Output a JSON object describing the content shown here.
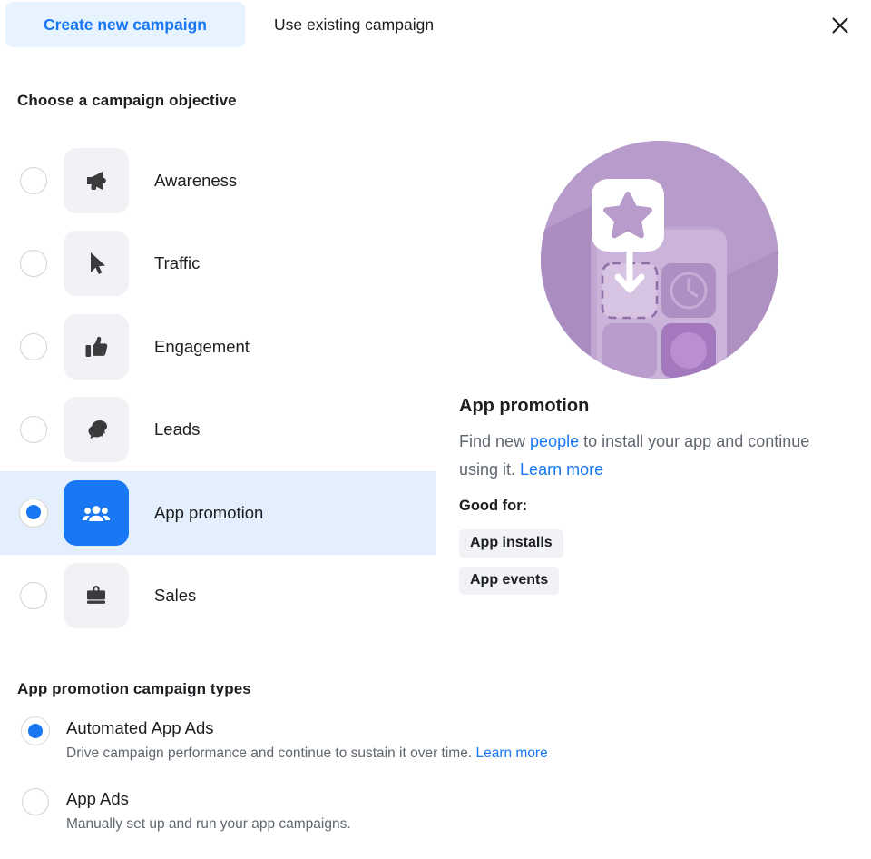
{
  "tabs": {
    "create_new": "Create new campaign",
    "use_existing": "Use existing campaign",
    "close_icon": "close-icon"
  },
  "objective_section": {
    "title": "Choose a campaign objective",
    "items": [
      {
        "label": "Awareness",
        "icon": "megaphone-icon",
        "selected": false
      },
      {
        "label": "Traffic",
        "icon": "cursor-icon",
        "selected": false
      },
      {
        "label": "Engagement",
        "icon": "thumbs-up-icon",
        "selected": false
      },
      {
        "label": "Leads",
        "icon": "speech-bubbles-icon",
        "selected": false
      },
      {
        "label": "App promotion",
        "icon": "people-icon",
        "selected": true
      },
      {
        "label": "Sales",
        "icon": "briefcase-icon",
        "selected": false
      }
    ]
  },
  "detail": {
    "illustration": "app-promotion-illustration",
    "title": "App promotion",
    "desc_part1": "Find new ",
    "desc_link1": "people",
    "desc_part2": " to install your app and continue using it. ",
    "desc_link2": "Learn more",
    "good_for_label": "Good for:",
    "badges": [
      "App installs",
      "App events"
    ]
  },
  "campaign_types": {
    "title": "App promotion campaign types",
    "options": [
      {
        "name": "Automated App Ads",
        "desc": "Drive campaign performance and continue to sustain it over time. ",
        "link": "Learn more",
        "selected": true
      },
      {
        "name": "App Ads",
        "desc": "Manually set up and run your app campaigns.",
        "link": "",
        "selected": false
      }
    ]
  },
  "colors": {
    "accent": "#1877f2",
    "tab_active_bg": "#e7f3ff",
    "row_selected_bg": "#e3effd",
    "icon_bg": "#f0f2f5",
    "text_primary": "#1c1e21",
    "text_secondary": "#606770",
    "illustration_purple": "#b89ecb"
  }
}
